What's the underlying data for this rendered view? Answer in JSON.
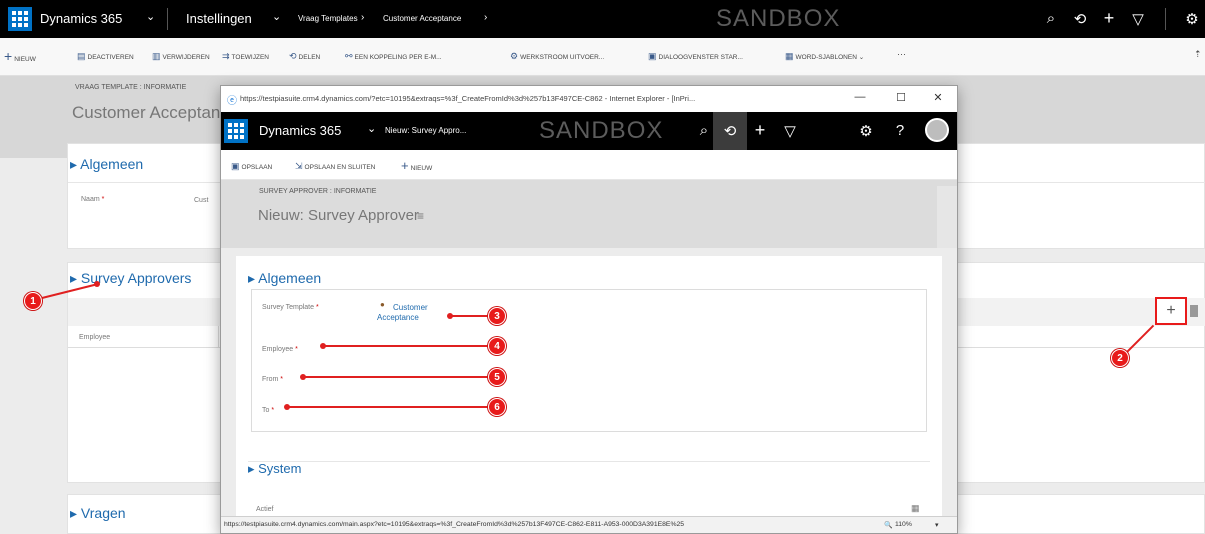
{
  "topnav": {
    "app_name": "Dynamics 365",
    "app_chevron": "⌄",
    "area": "Instellingen",
    "area_chevron": "⌄",
    "breadcrumb_1": "Vraag Templates",
    "breadcrumb_sep": "›",
    "breadcrumb_2": "Customer Acceptance",
    "breadcrumb_end": "›",
    "environment": "SANDBOX",
    "icons": [
      "search-icon",
      "history-icon",
      "plus-icon",
      "filter-icon",
      "settings-icon"
    ],
    "search_glyph": "⌕",
    "history_glyph": "⟲",
    "plus_glyph": "+",
    "filter_glyph": "▽",
    "settings_glyph": "⚙"
  },
  "cmdbar": {
    "new_glyph": "+",
    "new": "Nieuw",
    "deactivate": "Deactiveren",
    "delete": "Verwijderen",
    "assign": "Toewijzen",
    "share": "Delen",
    "email_link": "Een koppeling per e-m...",
    "workflow": "Werkstroom uitvoer...",
    "dialog": "Dialoogvenster star...",
    "word": "Word-sjablonen",
    "word_chevron": "⌄",
    "more": "···",
    "overflow": "⇡"
  },
  "bg_form": {
    "entity_label": "VRAAG TEMPLATE : INFORMATIE",
    "title": "Customer Acceptance",
    "section_general": "Algemeen",
    "field_name_label": "Naam",
    "field_name_value": "Cust",
    "section_approvers": "Survey Approvers",
    "grid_col_employee": "Employee",
    "section_questions": "Vragen",
    "add_glyph": "+"
  },
  "popup": {
    "ie_title": "https://testpiasuite.crm4.dynamics.com/?etc=10195&extraqs=%3f_CreateFromId%3d%257b13F497CE-C862 - Internet Explorer - [InPri...",
    "min": "—",
    "max": "☐",
    "close": "✕",
    "app_name": "Dynamics 365",
    "app_chevron": "⌄",
    "breadcrumb": "Nieuw: Survey Appro...",
    "environment": "SANDBOX",
    "search_glyph": "⌕",
    "history_glyph": "⟲",
    "plus_glyph": "+",
    "filter_glyph": "▽",
    "settings_glyph": "⚙",
    "help_glyph": "?",
    "cmd_save": "Opslaan",
    "cmd_save_close": "Opslaan en sluiten",
    "cmd_new": "Nieuw",
    "entity_label": "SURVEY APPROVER : INFORMATIE",
    "title": "Nieuw: Survey Approver",
    "title_icon": "≡",
    "section_general": "Algemeen",
    "field_survey_template_label": "Survey Template",
    "field_survey_template_value": "Customer Acceptance",
    "field_employee_label": "Employee",
    "field_from_label": "From",
    "field_to_label": "To",
    "section_system": "System",
    "actief_label": "Actief",
    "actief_glyph": "▦",
    "status_url": "https://testpiasuite.crm4.dynamics.com/main.aspx?etc=10195&extraqs=%3f_CreateFromId%3d%257b13F497CE-C862-E811-A953-000D3A391E8E%25",
    "zoom": "110%",
    "zoom_chevron": "▾"
  },
  "callouts": [
    "1",
    "2",
    "3",
    "4",
    "5",
    "6"
  ],
  "required_mark": "*",
  "colors": {
    "nav_bg": "#000000",
    "waffle": "#0072c6",
    "link_blue": "#1f6aad",
    "callout_red": "#e81a1a"
  }
}
